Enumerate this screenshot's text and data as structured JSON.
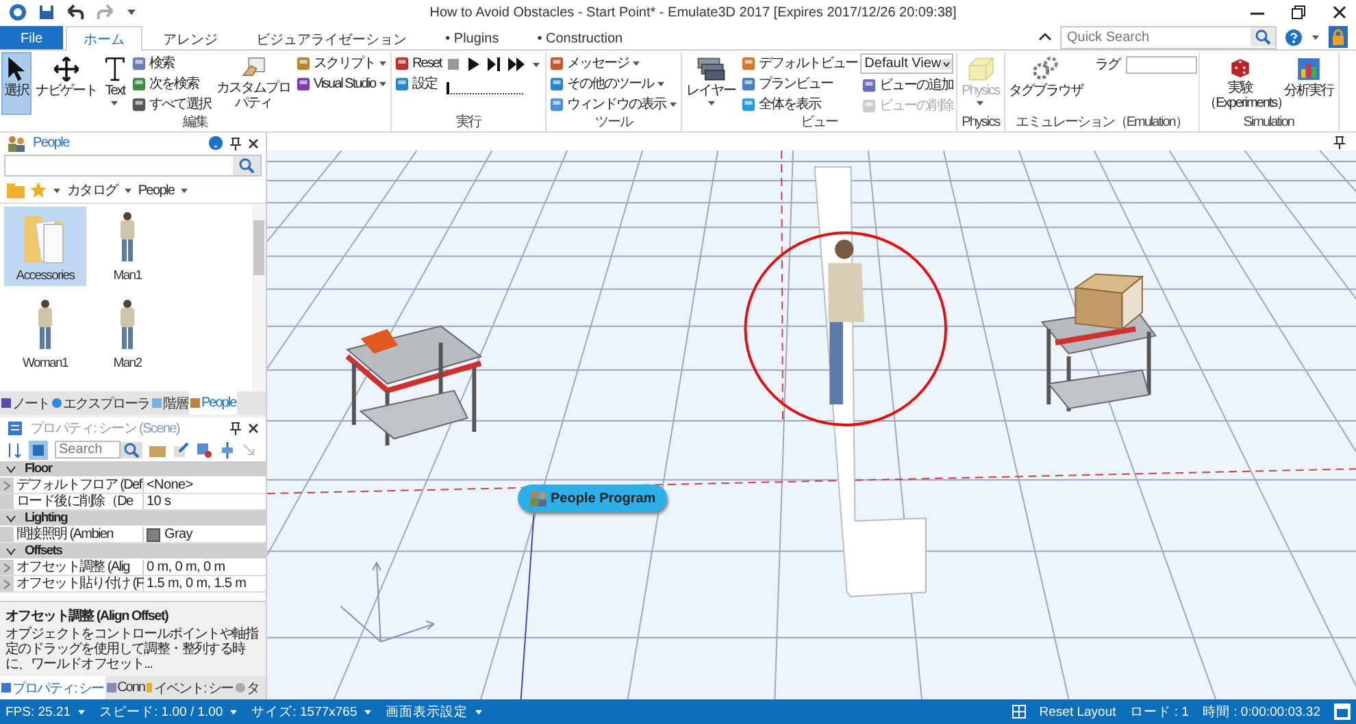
{
  "title_bar": {
    "title": "How to Avoid Obstacles - Start Point* - Emulate3D 2017 [Expires 2017/12/26 20:09:38]"
  },
  "quick_search": {
    "placeholder": "Quick Search"
  },
  "tabs": [
    {
      "label": "File",
      "kind": "file",
      "selected": false
    },
    {
      "label": "ホーム",
      "kind": "tab",
      "selected": true
    },
    {
      "label": "アレンジ",
      "kind": "tab",
      "selected": false
    },
    {
      "label": "ビジュアライゼーション",
      "kind": "tab",
      "selected": false
    },
    {
      "label": "• Plugins",
      "kind": "tab",
      "selected": false
    },
    {
      "label": "• Construction",
      "kind": "tab",
      "selected": false
    }
  ],
  "ribbon": [
    {
      "label": "編集",
      "items": [
        {
          "kind": "large",
          "label": "選択",
          "selected": true
        },
        {
          "kind": "large",
          "label": "ナビゲート",
          "selected": false
        },
        {
          "kind": "large",
          "label": "Text",
          "selected": false,
          "dropdown": true
        },
        {
          "kind": "small",
          "label": "検索"
        },
        {
          "kind": "small",
          "label": "次を検索"
        },
        {
          "kind": "small",
          "label": "すべて選択"
        },
        {
          "kind": "large",
          "label": "カスタムプロパティ"
        },
        {
          "kind": "small",
          "label": "スクリプト",
          "dropdown": true
        },
        {
          "kind": "small",
          "label": "Visual Studio",
          "dropdown": true
        }
      ]
    },
    {
      "label": "実行",
      "items": [
        {
          "kind": "small",
          "label": "Reset"
        },
        {
          "kind": "small",
          "label": "設定"
        },
        {
          "kind": "playback",
          "level": 0
        }
      ]
    },
    {
      "label": "ツール",
      "items": [
        {
          "kind": "small",
          "label": "メッセージ",
          "dropdown": true
        },
        {
          "kind": "small",
          "label": "その他のツール",
          "dropdown": true
        },
        {
          "kind": "small",
          "label": "ウィンドウの表示",
          "dropdown": true
        }
      ]
    },
    {
      "label": "ビュー",
      "items": [
        {
          "kind": "large",
          "label": "レイヤー",
          "dropdown": true
        },
        {
          "kind": "small",
          "label": "デフォルトビュー"
        },
        {
          "kind": "small",
          "label": "プランビュー"
        },
        {
          "kind": "small",
          "label": "全体を表示"
        },
        {
          "kind": "combo",
          "label": "Default View"
        },
        {
          "kind": "small",
          "label": "ビューの追加"
        },
        {
          "kind": "small",
          "label": "ビューの削除",
          "disabled": true
        }
      ]
    },
    {
      "label": "Physics",
      "items": [
        {
          "kind": "large",
          "label": "Physics",
          "dropdown": true,
          "disabled": true
        }
      ]
    },
    {
      "label": "エミュレーション（Emulation）",
      "items": [
        {
          "kind": "large",
          "label": "タグブラウザ"
        },
        {
          "kind": "field",
          "label": "ラグ"
        }
      ]
    },
    {
      "label": "Simulation",
      "items": [
        {
          "kind": "large",
          "label": "実験（Experiments）"
        },
        {
          "kind": "large",
          "label": "分析実行"
        }
      ]
    }
  ],
  "people_panel": {
    "title": "People",
    "breadcrumb": [
      "カタログ",
      "People"
    ],
    "items": [
      {
        "label": "Accessories",
        "kind": "folder",
        "selected": true
      },
      {
        "label": "Man1",
        "kind": "person",
        "selected": false
      },
      {
        "label": "Woman1",
        "kind": "person",
        "selected": false
      },
      {
        "label": "Man2",
        "kind": "person",
        "selected": false
      }
    ],
    "tabs": [
      {
        "label": "ノート",
        "selected": false
      },
      {
        "label": "エクスプローラ",
        "selected": false
      },
      {
        "label": "階層",
        "selected": false
      },
      {
        "label": "People",
        "selected": true
      }
    ]
  },
  "properties_panel": {
    "title": "プロパティ: シーン (Scene)",
    "search": {
      "placeholder": "Search"
    },
    "groups": [
      {
        "label": "Floor",
        "expanded": true,
        "rows": [
          {
            "name": "デフォルトフロア (Def",
            "value": "<None>",
            "expandable": true
          },
          {
            "name": "ロード後に削除（De",
            "value": "10 s",
            "expandable": false
          }
        ]
      },
      {
        "label": "Lighting",
        "expanded": true,
        "rows": [
          {
            "name": "間接照明 (Ambien",
            "value": "Gray",
            "color": "#808080",
            "expandable": false
          }
        ]
      },
      {
        "label": "Offsets",
        "expanded": true,
        "rows": [
          {
            "name": "オフセット調整 (Alig",
            "value": "0 m, 0 m, 0 m",
            "expandable": true
          },
          {
            "name": "オフセット貼り付け (F",
            "value": "1.5 m, 0 m, 1.5 m",
            "expandable": true
          }
        ]
      }
    ],
    "description": {
      "title": "オフセット調整 (Align Offset)",
      "text": "オブジェクトをコントロールポイントや軸指定のドラッグを使用して調整・整列する時に、ワールドオフセット..."
    },
    "tabs": [
      {
        "label": "プロパティ: シー",
        "selected": true
      },
      {
        "label": "Conn",
        "selected": false
      },
      {
        "label": "イベント: シー",
        "selected": false
      },
      {
        "label": "タ",
        "selected": false
      }
    ]
  },
  "viewport": {
    "program_label": "People Program"
  },
  "status_bar": {
    "left": [
      {
        "label": "FPS: 25.21",
        "dropdown": true
      },
      {
        "label": "スピード: 1.00 / 1.00",
        "dropdown": true
      },
      {
        "label": "サイズ: 1577x765",
        "dropdown": true
      },
      {
        "label": "画面表示設定",
        "dropdown": true
      }
    ],
    "right": [
      {
        "label": "Reset Layout"
      },
      {
        "label": "ロード : 1"
      },
      {
        "label": "時間 : 0:00:00:03.32"
      }
    ]
  }
}
